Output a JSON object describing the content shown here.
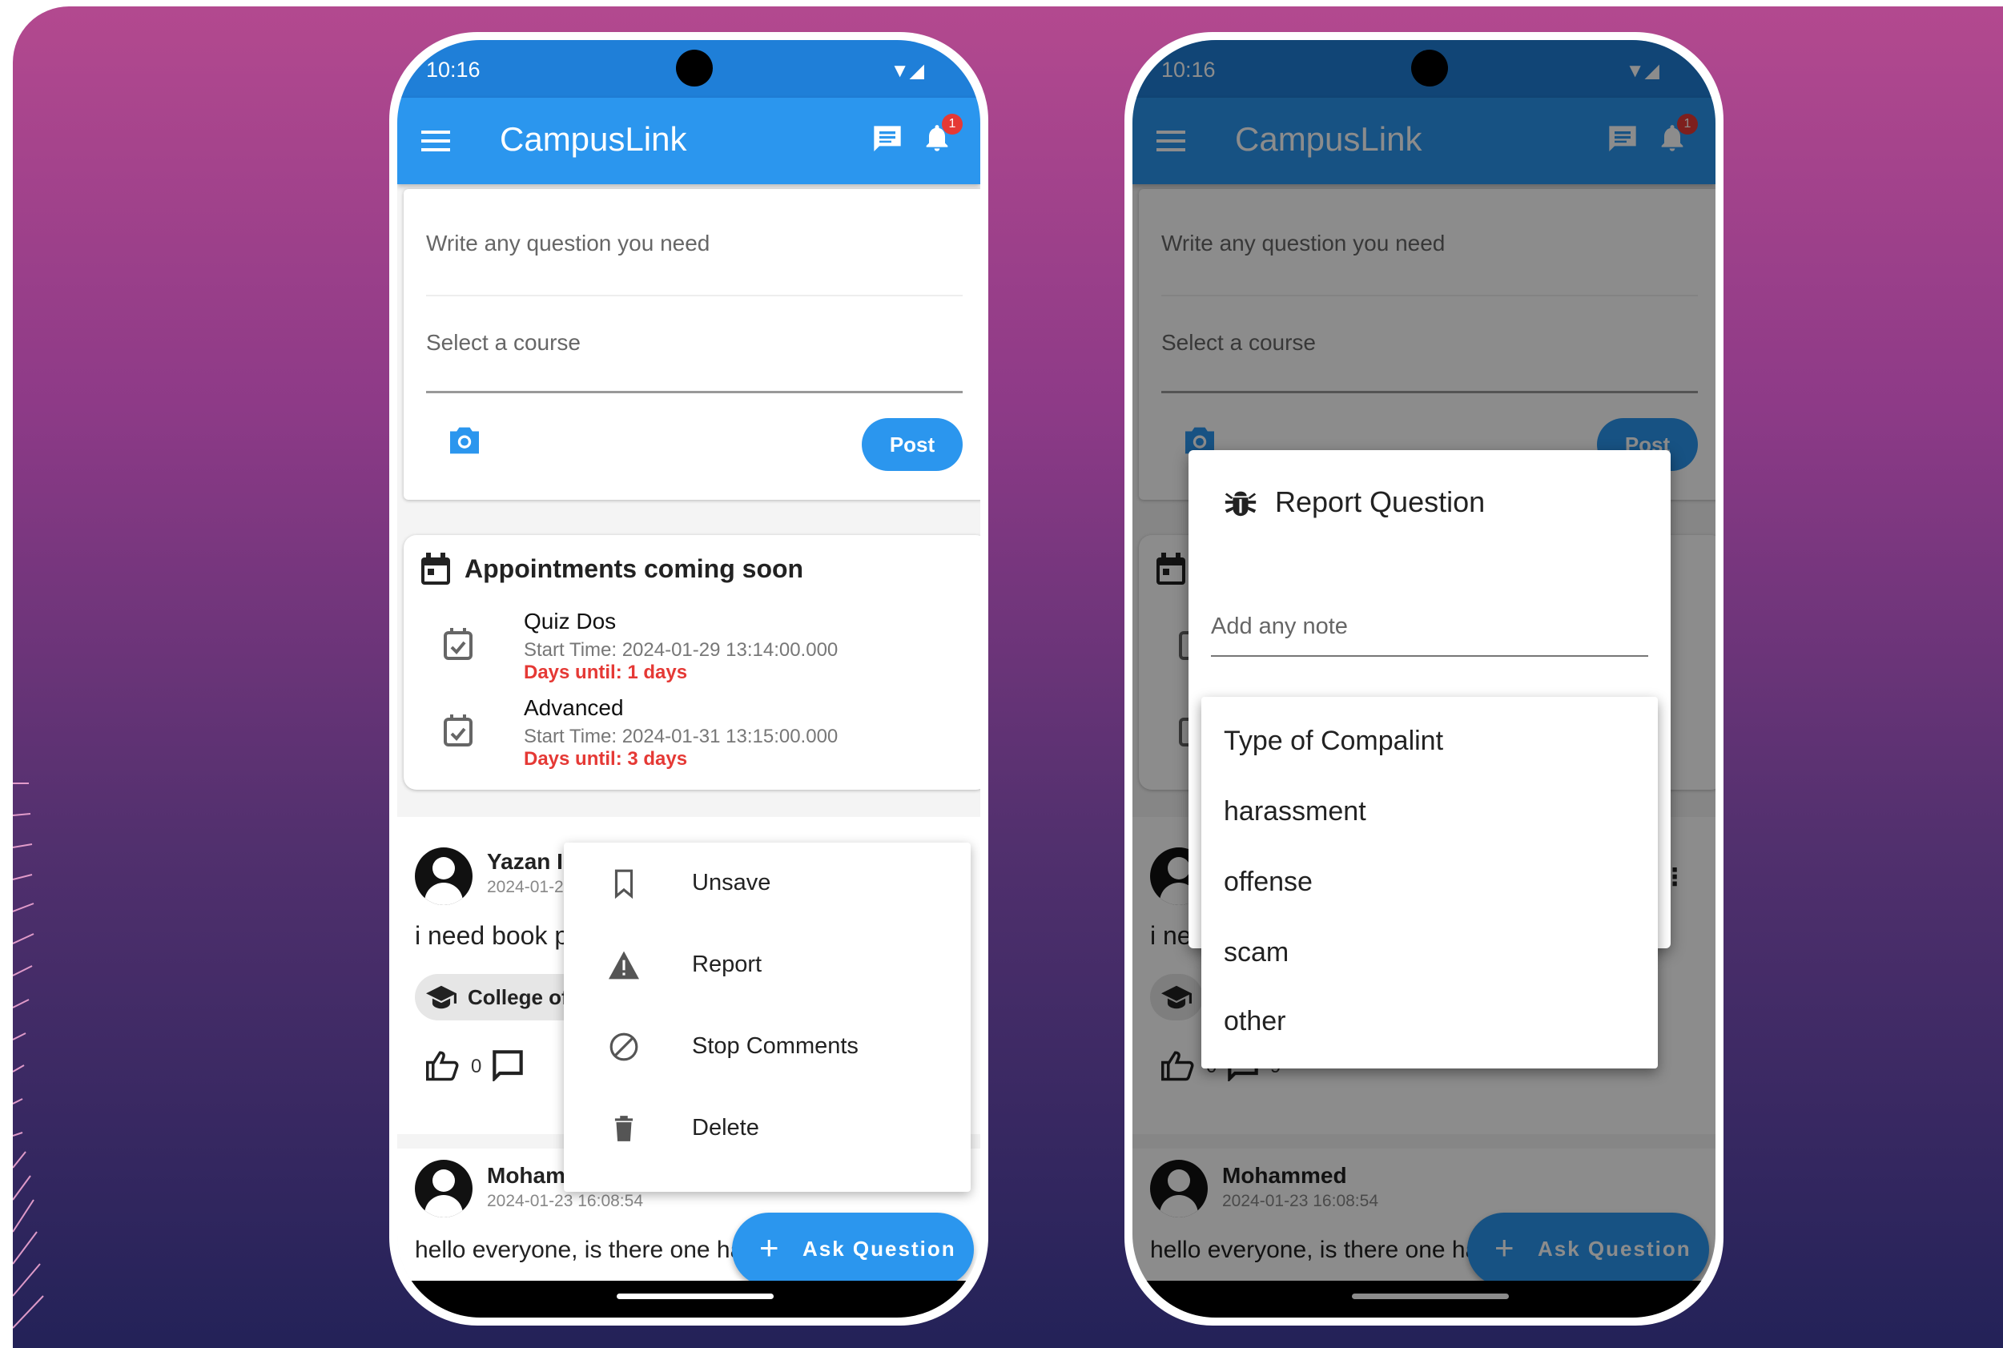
{
  "status": {
    "time": "10:16",
    "notification_count": "1"
  },
  "app": {
    "title": "CampusLink"
  },
  "compose": {
    "question_placeholder": "Write any question you need",
    "course_placeholder": "Select a course",
    "post_label": "Post"
  },
  "appointments": {
    "title": "Appointments coming soon",
    "items": [
      {
        "name": "Quiz Dos",
        "start": "Start Time: 2024-01-29 13:14:00.000",
        "until": "Days until: 1 days"
      },
      {
        "name": "Advanced",
        "start": "Start Time: 2024-01-31 13:15:00.000",
        "until": "Days until: 3 days"
      }
    ]
  },
  "posts": [
    {
      "author": "Yazan I",
      "timestamp": "2024-01-2",
      "text": "i need book p",
      "course": "College of",
      "likes": "0"
    },
    {
      "author": "Mohammed",
      "timestamp": "2024-01-23 16:08:54",
      "text": "hello everyone, is there one has summary for"
    }
  ],
  "right_post": {
    "author_partial": "i ne",
    "likes": "0",
    "comments": "9"
  },
  "post_menu": {
    "items": [
      "Unsave",
      "Report",
      "Stop Comments",
      "Delete"
    ]
  },
  "fab": {
    "label": "Ask Question"
  },
  "report_dialog": {
    "title": "Report Question",
    "note_placeholder": "Add any note",
    "options": [
      "Type of Compalint",
      "harassment",
      "offense",
      "scam",
      "other"
    ]
  },
  "colors": {
    "primary": "#2b96ee",
    "status_bar": "#1f7fd8",
    "alert": "#e53935",
    "background_top": "#b3498f",
    "background_bottom": "#232258"
  }
}
